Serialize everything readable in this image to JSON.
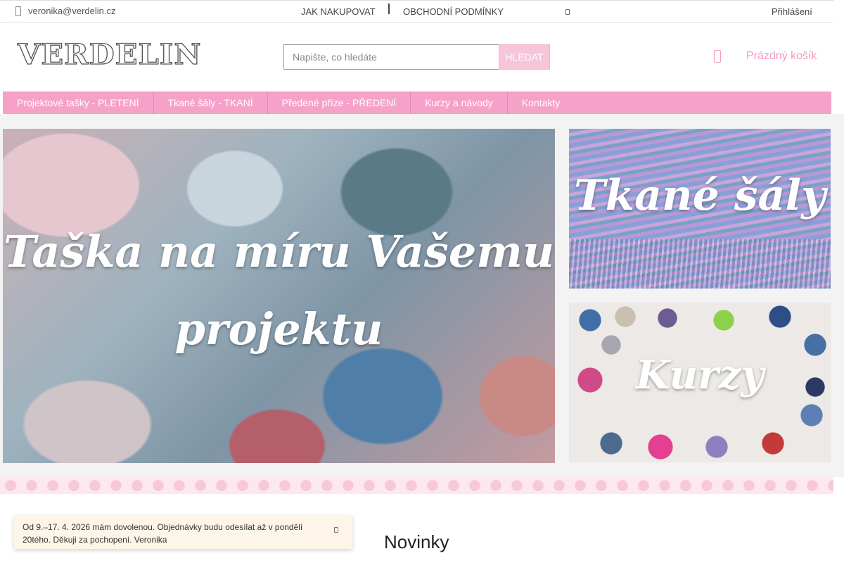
{
  "topbar": {
    "email": "veronika@verdelin.cz",
    "how_to_buy": "JAK NAKUPOVAT",
    "terms": "OBCHODNÍ PODMÍNKY",
    "login": "Přihlášení"
  },
  "header": {
    "logo": "VERDELIN",
    "search_placeholder": "Napište, co hledáte",
    "search_button": "HLEDAT",
    "cart": "Prázdný košík"
  },
  "nav": {
    "items": [
      {
        "label": "Projektové tašky - PLETENÍ"
      },
      {
        "label": "Tkané šály - TKANÍ"
      },
      {
        "label": "Předené příze - PŘEDENÍ"
      },
      {
        "label": "Kurzy a návody"
      },
      {
        "label": "Kontakty"
      }
    ]
  },
  "banners": {
    "main": {
      "line1": "Taška na míru Vašemu",
      "line2": "projektu"
    },
    "top_right": "Tkané šály",
    "bottom_right": "Kurzy"
  },
  "notice": {
    "text": "Od 9.–17. 4. 2026 mám dovolenou. Objednávky budu odesílat až v pondělí 20tého. Děkuji za pochopení. Veronika"
  },
  "section": {
    "title": "Novinky"
  },
  "colors": {
    "accent_pink": "#f6a2c8",
    "cart_pink": "#f29bc3"
  },
  "icons": [
    "envelope-icon",
    "cart-icon",
    "close-icon",
    "small-icon"
  ]
}
